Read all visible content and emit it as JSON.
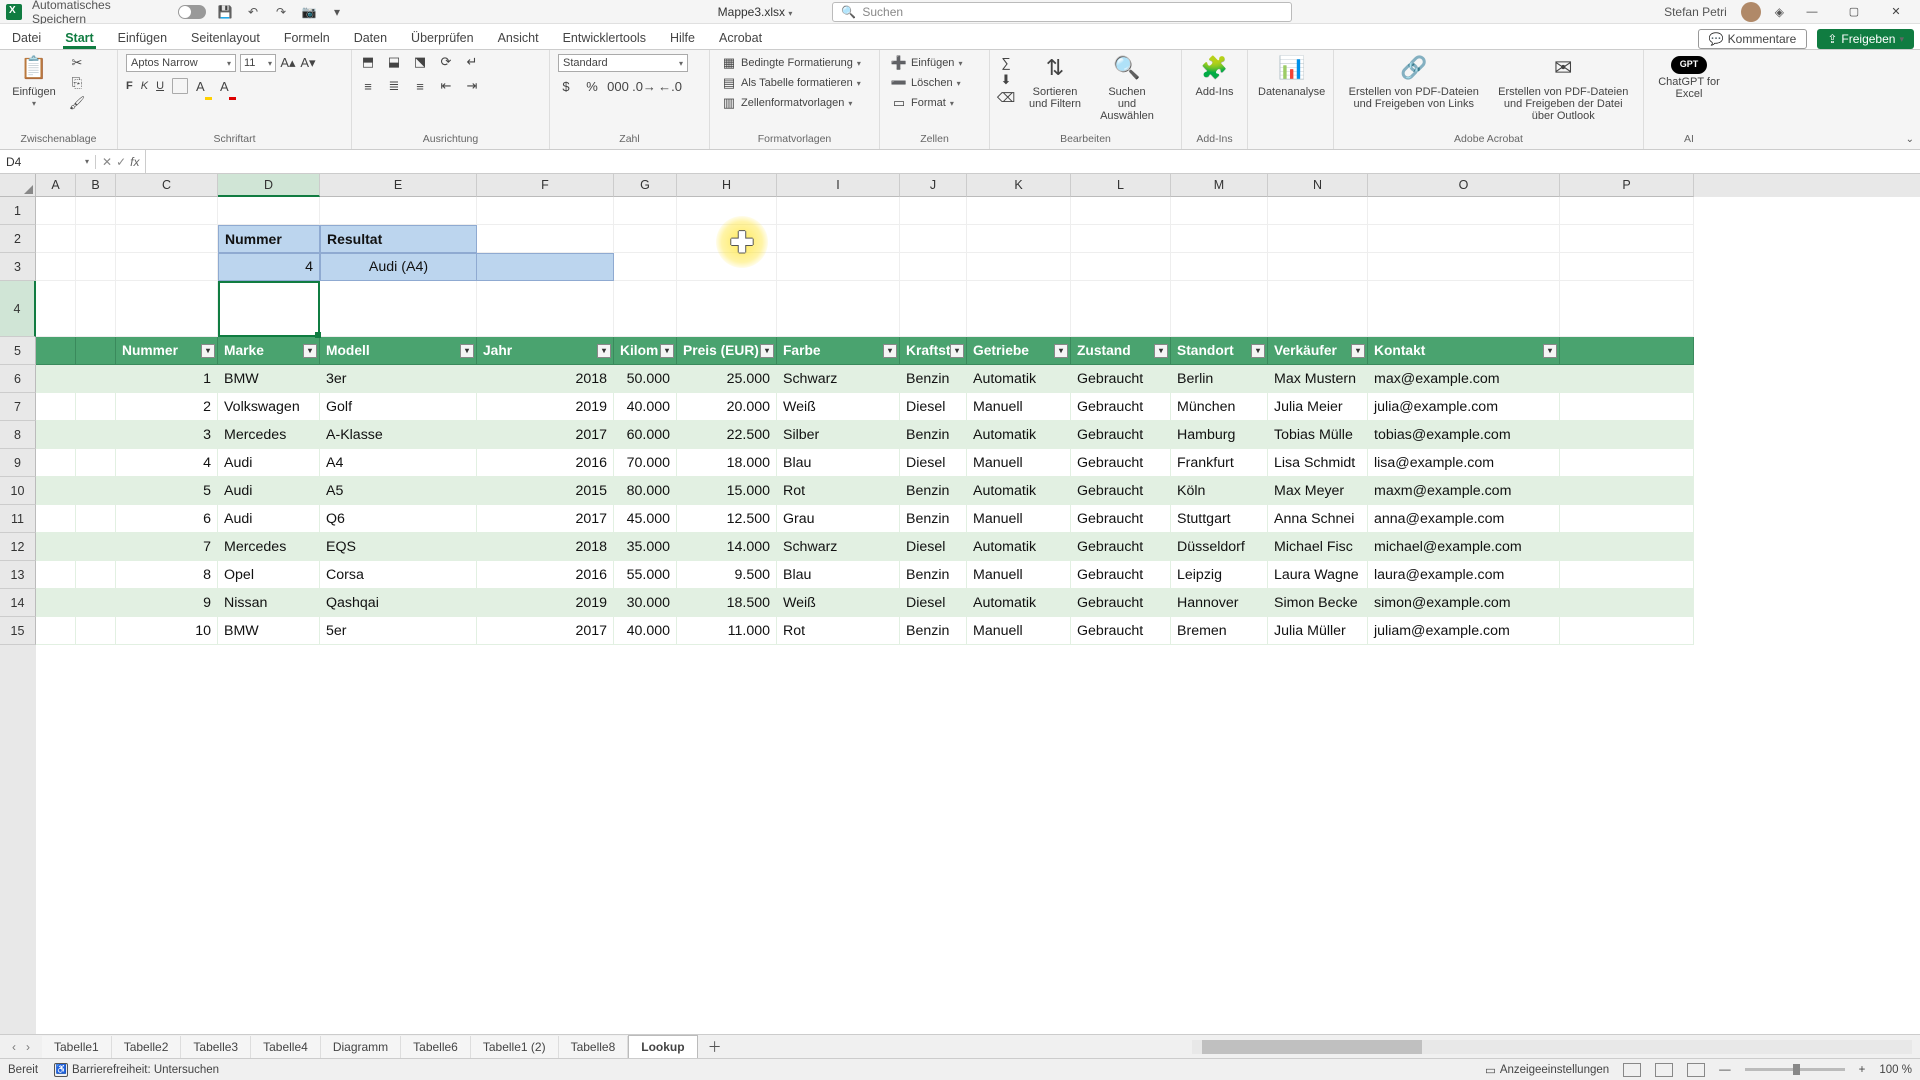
{
  "titlebar": {
    "autosave_label": "Automatisches Speichern",
    "filename": "Mappe3.xlsx",
    "search_placeholder": "Suchen",
    "user_name": "Stefan Petri"
  },
  "tabs": {
    "items": [
      "Datei",
      "Start",
      "Einfügen",
      "Seitenlayout",
      "Formeln",
      "Daten",
      "Überprüfen",
      "Ansicht",
      "Entwicklertools",
      "Hilfe",
      "Acrobat"
    ],
    "active_index": 1,
    "comments": "Kommentare",
    "share": "Freigeben"
  },
  "ribbon": {
    "clipboard": {
      "paste": "Einfügen",
      "title": "Zwischenablage"
    },
    "font": {
      "name": "Aptos Narrow",
      "size": "11",
      "title": "Schriftart"
    },
    "align": {
      "title": "Ausrichtung"
    },
    "number": {
      "format": "Standard",
      "title": "Zahl"
    },
    "styles": {
      "cond": "Bedingte Formatierung",
      "table": "Als Tabelle formatieren",
      "cell": "Zellenformatvorlagen",
      "title": "Formatvorlagen"
    },
    "cells": {
      "ins": "Einfügen",
      "del": "Löschen",
      "fmt": "Format",
      "title": "Zellen"
    },
    "editing": {
      "sortfilter": "Sortieren und Filtern",
      "findselect": "Suchen und Auswählen",
      "title": "Bearbeiten"
    },
    "addins": {
      "btn": "Add-Ins",
      "title": "Add-Ins"
    },
    "dataanalysis": "Datenanalyse",
    "acrobat": {
      "a": "Erstellen von PDF-Dateien und Freigeben von Links",
      "b": "Erstellen von PDF-Dateien und Freigeben der Datei über Outlook",
      "title": "Adobe Acrobat"
    },
    "gpt": {
      "btn": "ChatGPT for Excel",
      "title": "AI"
    }
  },
  "formula": {
    "name_box": "D4",
    "value": ""
  },
  "columns": {
    "letters": [
      "A",
      "B",
      "C",
      "D",
      "E",
      "F",
      "G",
      "H",
      "I",
      "J",
      "K",
      "L",
      "M",
      "N",
      "O",
      "P"
    ],
    "widths": [
      40,
      40,
      102,
      102,
      157,
      137,
      63,
      100,
      123,
      67,
      104,
      100,
      97,
      100,
      192,
      134
    ],
    "selected_index": 3
  },
  "rows": {
    "count": 15,
    "heights_tall": [
      4
    ],
    "selected_index": 4
  },
  "mini_table": {
    "header": [
      "Nummer",
      "Resultat"
    ],
    "value_num": "4",
    "value_res": "Audi (A4)"
  },
  "table": {
    "headers": [
      "Nummer",
      "Marke",
      "Modell",
      "Jahr",
      "Kilom",
      "Preis (EUR)",
      "Farbe",
      "Kraftst",
      "Getriebe",
      "Zustand",
      "Standort",
      "Verkäufer",
      "Kontakt"
    ],
    "rows": [
      [
        "1",
        "BMW",
        "3er",
        "2018",
        "50.000",
        "25.000",
        "Schwarz",
        "Benzin",
        "Automatik",
        "Gebraucht",
        "Berlin",
        "Max Mustern",
        "max@example.com"
      ],
      [
        "2",
        "Volkswagen",
        "Golf",
        "2019",
        "40.000",
        "20.000",
        "Weiß",
        "Diesel",
        "Manuell",
        "Gebraucht",
        "München",
        "Julia Meier",
        "julia@example.com"
      ],
      [
        "3",
        "Mercedes",
        "A-Klasse",
        "2017",
        "60.000",
        "22.500",
        "Silber",
        "Benzin",
        "Automatik",
        "Gebraucht",
        "Hamburg",
        "Tobias Mülle",
        "tobias@example.com"
      ],
      [
        "4",
        "Audi",
        "A4",
        "2016",
        "70.000",
        "18.000",
        "Blau",
        "Diesel",
        "Manuell",
        "Gebraucht",
        "Frankfurt",
        "Lisa Schmidt",
        "lisa@example.com"
      ],
      [
        "5",
        "Audi",
        "A5",
        "2015",
        "80.000",
        "15.000",
        "Rot",
        "Benzin",
        "Automatik",
        "Gebraucht",
        "Köln",
        "Max Meyer",
        "maxm@example.com"
      ],
      [
        "6",
        "Audi",
        "Q6",
        "2017",
        "45.000",
        "12.500",
        "Grau",
        "Benzin",
        "Manuell",
        "Gebraucht",
        "Stuttgart",
        "Anna Schnei",
        "anna@example.com"
      ],
      [
        "7",
        "Mercedes",
        "EQS",
        "2018",
        "35.000",
        "14.000",
        "Schwarz",
        "Diesel",
        "Automatik",
        "Gebraucht",
        "Düsseldorf",
        "Michael Fisc",
        "michael@example.com"
      ],
      [
        "8",
        "Opel",
        "Corsa",
        "2016",
        "55.000",
        "9.500",
        "Blau",
        "Benzin",
        "Manuell",
        "Gebraucht",
        "Leipzig",
        "Laura Wagne",
        "laura@example.com"
      ],
      [
        "9",
        "Nissan",
        "Qashqai",
        "2019",
        "30.000",
        "18.500",
        "Weiß",
        "Diesel",
        "Automatik",
        "Gebraucht",
        "Hannover",
        "Simon Becke",
        "simon@example.com"
      ],
      [
        "10",
        "BMW",
        "5er",
        "2017",
        "40.000",
        "11.000",
        "Rot",
        "Benzin",
        "Manuell",
        "Gebraucht",
        "Bremen",
        "Julia Müller",
        "juliam@example.com"
      ]
    ]
  },
  "sheets": {
    "items": [
      "Tabelle1",
      "Tabelle2",
      "Tabelle3",
      "Tabelle4",
      "Diagramm",
      "Tabelle6",
      "Tabelle1 (2)",
      "Tabelle8",
      "Lookup"
    ],
    "active_index": 8
  },
  "status": {
    "ready": "Bereit",
    "accessibility": "Barrierefreiheit: Untersuchen",
    "display_settings": "Anzeigeeinstellungen",
    "zoom": "100 %"
  }
}
